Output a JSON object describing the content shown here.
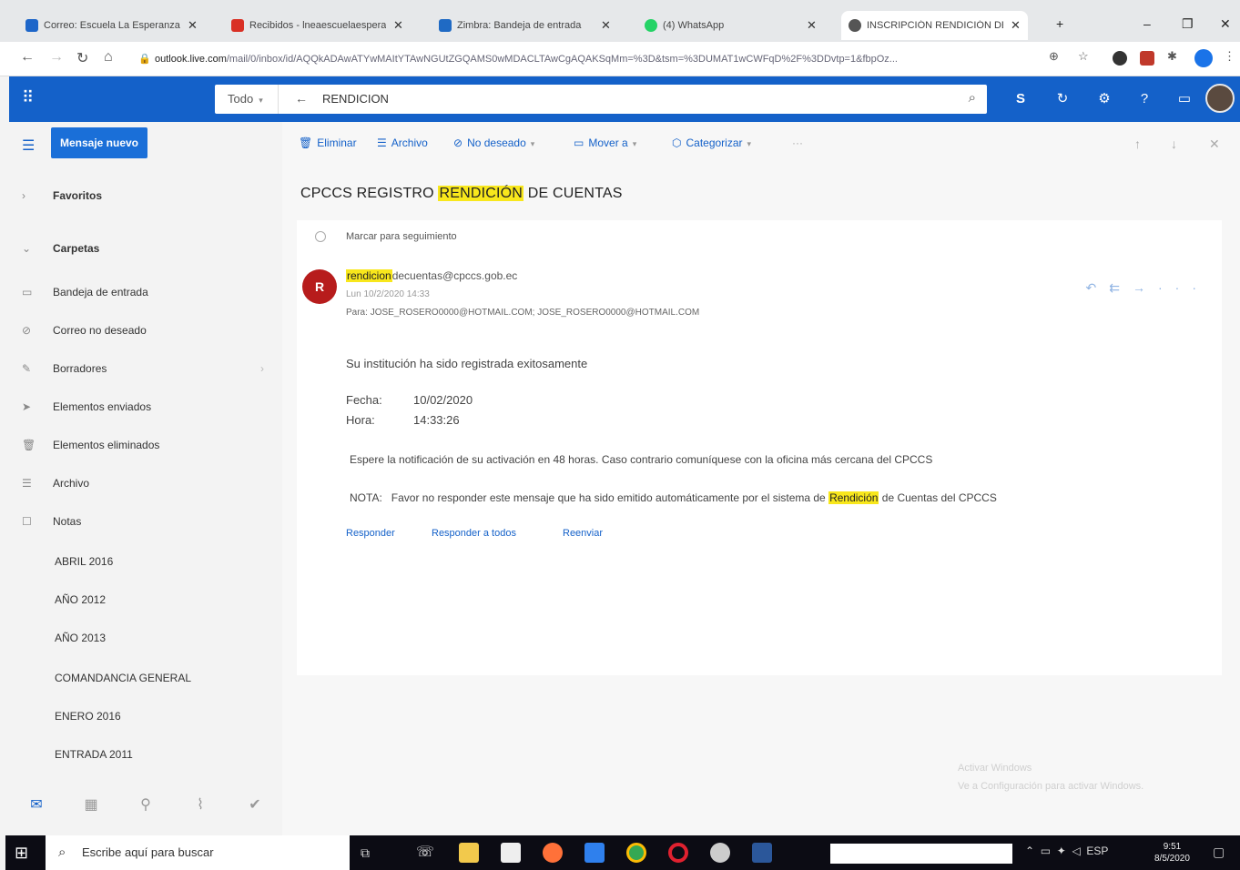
{
  "browser": {
    "tabs": [
      {
        "title": "Correo: Escuela La Esperanza -",
        "favicon_color": "#1e66c9",
        "active": false
      },
      {
        "title": "Recibidos - lneaescuelaesperanza",
        "favicon_color": "#d93025",
        "active": false
      },
      {
        "title": "Zimbra: Bandeja de entrada",
        "favicon_color": "#1f6ac4",
        "active": false
      },
      {
        "title": "(4) WhatsApp",
        "favicon_color": "#25d366",
        "active": false
      },
      {
        "title": "INSCRIPCIÓN RENDICIÓN DE C",
        "favicon_color": "#555555",
        "active": true
      }
    ],
    "new_tab": "+",
    "window_controls": {
      "minimize": "–",
      "restore": "❐",
      "close": "✕"
    },
    "url_host": "outlook.live.com",
    "url_rest": "/mail/0/inbox/id/AQQkADAwATYwMAItYTAwNGUtZGQAMS0wMDACLTAwCgAQAKSqMm=%3D&tsm=%3DUMAT1wCWFqD%2F%3DDvtp=1&fbpOz..."
  },
  "header": {
    "search_scope": "Todo",
    "search_query": "RENDICION"
  },
  "sidebar": {
    "new_mail_label": "Mensaje nuevo",
    "favorites_label": "Favoritos",
    "folders_label": "Carpetas",
    "folders": [
      {
        "label": "Bandeja de entrada",
        "icon": "inbox-icon",
        "glyph": "▭"
      },
      {
        "label": "Correo no deseado",
        "icon": "junk-icon",
        "glyph": "⊘"
      },
      {
        "label": "Borradores",
        "icon": "pencil-icon",
        "glyph": "✎"
      },
      {
        "label": "Elementos enviados",
        "icon": "send-icon",
        "glyph": "➤"
      },
      {
        "label": "Elementos eliminados",
        "icon": "trash-icon",
        "glyph": "🗑"
      },
      {
        "label": "Archivo",
        "icon": "archive-icon",
        "glyph": "☰"
      },
      {
        "label": "Notas",
        "icon": "notes-icon",
        "glyph": "☐"
      }
    ],
    "subfolders": [
      "ABRIL 2016",
      "AÑO 2012",
      "AÑO 2013",
      "COMANDANCIA GENERAL",
      "ENERO 2016",
      "ENTRADA 2011"
    ]
  },
  "toolbar": {
    "delete_label": "Eliminar",
    "archive_label": "Archivo",
    "junk_label": "No deseado",
    "move_label": "Mover a",
    "categorize_label": "Categorizar",
    "more_label": "···"
  },
  "message": {
    "subject_pre": "CPCCS REGISTRO ",
    "subject_highlight": "RENDICIÓN",
    "subject_post": " DE CUENTAS",
    "flag_text": "Marcar para seguimiento",
    "avatar_initial": "R",
    "from_highlight": "rendicion",
    "from_rest": "decuentas@cpccs.gob.ec",
    "date": "Lun 10/2/2020 14:33",
    "to_prefix": "Para:",
    "to_rest": "JOSE_ROSERO0000@HOTMAIL.COM; JOSE_ROSERO0000@HOTMAIL.COM",
    "line1": "Su institución ha sido registrada exitosamente",
    "fecha_label": "Fecha:",
    "fecha_value": "10/02/2020",
    "hora_label": "Hora:",
    "hora_value": "14:33:26",
    "line2": "Espere la notificación de su activación en 48 horas. Caso contrario comuníquese con la oficina más cercana del CPCCS",
    "nota_label": "NOTA:",
    "nota_pre": "Favor no responder este mensaje que ha sido emitido automáticamente por el sistema de ",
    "nota_highlight": "Rendición",
    "nota_post": " de Cuentas del CPCCS",
    "reply_label": "Responder",
    "reply_all_label": "Responder a todos",
    "forward_label": "Reenviar"
  },
  "watermark": {
    "line1": "Activar Windows",
    "line2": "Ve a Configuración para activar Windows."
  },
  "taskbar": {
    "search_placeholder": "Escribe aquí para buscar",
    "time": "9:51",
    "date": "8/5/2020",
    "language": "ESP"
  },
  "colors": {
    "accent": "#1461c9",
    "highlight": "#f8e71c",
    "sender_avatar": "#b71c1c"
  }
}
